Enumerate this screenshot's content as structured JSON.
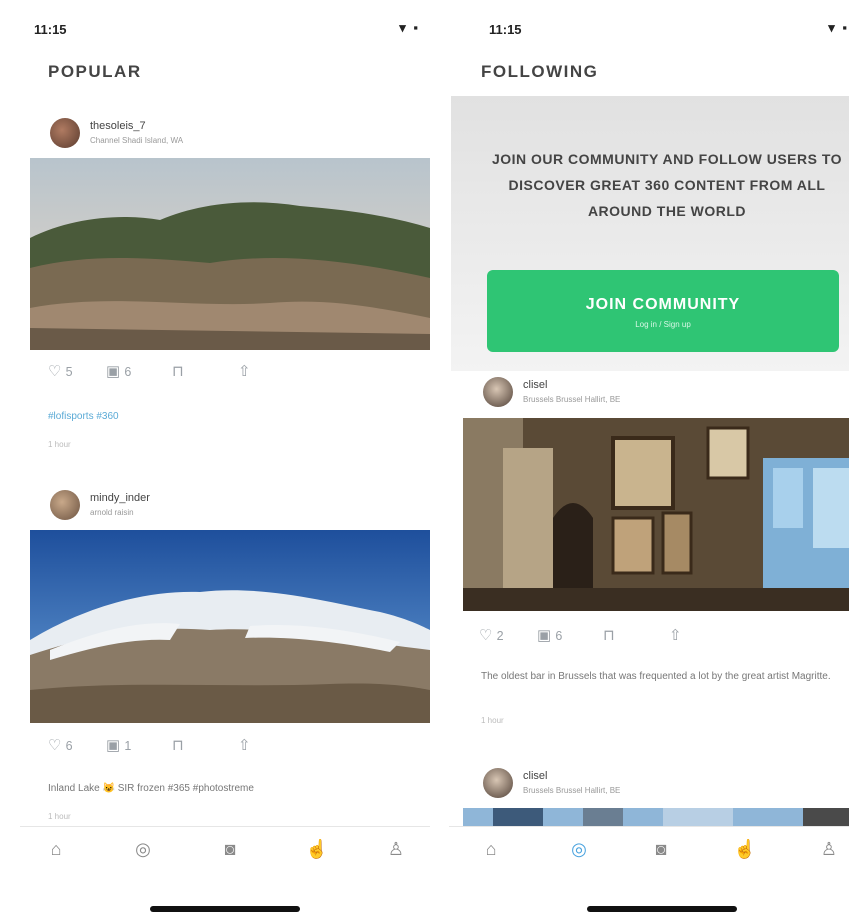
{
  "status_bar": {
    "time": "11:15",
    "icons": "▾ ▪"
  },
  "left_screen": {
    "title": "POPULAR",
    "posts": [
      {
        "username": "thesoleis_7",
        "location": "Channel Shadi Island, WA",
        "likes": "5",
        "comments": "6",
        "caption": "#lofisports #360",
        "time_ago": "1 hour"
      },
      {
        "username": "mindy_inder",
        "location": "arnold raisin",
        "likes": "6",
        "comments": "1",
        "caption": "Inland Lake 😺 SIR frozen #365 #photostreme",
        "time_ago": "1 hour"
      }
    ]
  },
  "right_screen": {
    "title": "FOLLOWING",
    "banner_text": "JOIN OUR COMMUNITY AND FOLLOW USERS TO DISCOVER GREAT 360 CONTENT FROM ALL AROUND THE WORLD",
    "join_button": {
      "label": "JOIN COMMUNITY",
      "sublabel": "Log in / Sign up"
    },
    "posts": [
      {
        "username": "clisel",
        "location": "Brussels Brussel Hallirt, BE",
        "likes": "2",
        "comments": "6",
        "caption": "The oldest bar in Brussels that was frequented a lot by the great artist Magritte.",
        "time_ago": "1 hour"
      },
      {
        "username": "clisel",
        "location": "Brussels Brussel Hallirt, BE"
      }
    ]
  },
  "icons": {
    "like": "heart-icon",
    "comment": "comment-icon",
    "bookmark": "bookmark-icon",
    "share": "share-icon",
    "tab_home": "home-icon",
    "tab_explore": "compass-icon",
    "tab_camera": "camera-icon",
    "tab_popular": "thumbs-up-icon",
    "tab_profile": "profile-icon"
  },
  "colors": {
    "join_button": "#2fc574",
    "active_tab": "#4aa3df",
    "hashtag": "#5aaad6"
  }
}
